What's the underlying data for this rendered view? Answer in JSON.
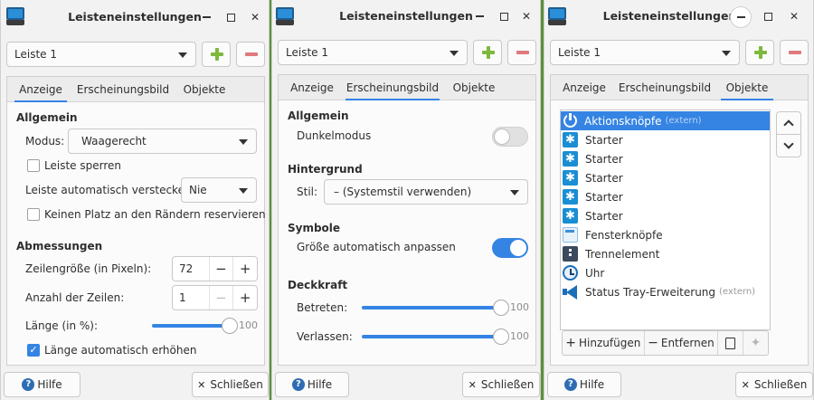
{
  "window_title": "Leisteneinstellungen",
  "panel_selector": "Leiste 1",
  "tabs": [
    "Anzeige",
    "Erscheinungsbild",
    "Objekte"
  ],
  "help_label": "Hilfe",
  "close_label": "Schließen",
  "accent": "#3584e4",
  "w1": {
    "general_header": "Allgemein",
    "mode_label": "Modus:",
    "mode_value": "Waagerecht",
    "lock_label": "Leiste sperren",
    "autohide_label": "Leiste automatisch verstecken:",
    "autohide_value": "Nie",
    "reserve_label": "Keinen Platz an den Rändern reservieren",
    "dims_header": "Abmessungen",
    "rowsize_label": "Zeilengröße (in Pixeln):",
    "rowsize_value": "72",
    "rows_label": "Anzahl der Zeilen:",
    "rows_value": "1",
    "length_label": "Länge (in %):",
    "length_value": "100",
    "length_fraction": 1.0,
    "autogrow_label": "Länge automatisch erhöhen",
    "autogrow_checked": true,
    "lock_checked": false,
    "reserve_checked": false
  },
  "w2": {
    "general_header": "Allgemein",
    "dark_label": "Dunkelmodus",
    "dark_on": false,
    "bg_header": "Hintergrund",
    "style_label": "Stil:",
    "style_value": "– (Systemstil verwenden)",
    "icons_header": "Symbole",
    "autosize_label": "Größe automatisch anpassen",
    "autosize_on": true,
    "opacity_header": "Deckkraft",
    "enter_label": "Betreten:",
    "enter_value": "100",
    "leave_label": "Verlassen:",
    "leave_value": "100"
  },
  "w3": {
    "items": [
      {
        "label": "Aktionsknöpfe",
        "tag": "(extern)",
        "icon": "power-icon",
        "selected": true
      },
      {
        "label": "Starter",
        "tag": "",
        "icon": "gear-icon"
      },
      {
        "label": "Starter",
        "tag": "",
        "icon": "gear-icon"
      },
      {
        "label": "Starter",
        "tag": "",
        "icon": "gear-icon"
      },
      {
        "label": "Starter",
        "tag": "",
        "icon": "gear-icon"
      },
      {
        "label": "Starter",
        "tag": "",
        "icon": "gear-icon"
      },
      {
        "label": "Fensterknöpfe",
        "tag": "",
        "icon": "window-buttons-icon"
      },
      {
        "label": "Trennelement",
        "tag": "",
        "icon": "separator-icon"
      },
      {
        "label": "Uhr",
        "tag": "",
        "icon": "clock-icon"
      },
      {
        "label": "Status Tray-Erweiterung",
        "tag": "(extern)",
        "icon": "megaphone-icon"
      }
    ],
    "add_label": "Hinzufügen",
    "remove_label": "Entfernen"
  }
}
